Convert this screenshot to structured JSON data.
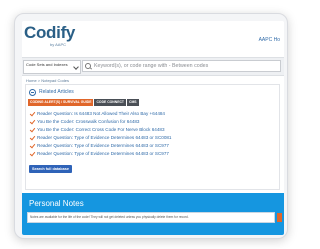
{
  "header": {
    "logo_text": "Codify",
    "logo_byline": "by AAPC",
    "right_link": "AAPC Ho"
  },
  "search": {
    "code_select_label": "Code Sets and Indexes",
    "placeholder": "Keyword(s), or code range with - Between codes"
  },
  "breadcrumb": "Home > Notepad Codes",
  "articles": {
    "title": "Related Articles",
    "tabs": [
      {
        "label": "CODING ALERT(S) / SURVIVAL GUIDE"
      },
      {
        "label": "CODE CONNECT"
      },
      {
        "label": "CMS"
      }
    ],
    "items": [
      "Reader Question: Is 64483 Not Allowed Their Also Bay +64484",
      "You Be the Coder: Crosswalk Confusion for 64483",
      "You Be the Coder: Correct Cross Code For Nerve Block 64483",
      "Reader Question: Type of Evidence Determines 64483 or SC0081",
      "Reader Question: Type of Evidence Determines 64483 or SC977",
      "Reader Question: Type of Evidence Determines 64483 or SC977"
    ],
    "full_db_button": "Search full database"
  },
  "notes": {
    "title": "Personal Notes",
    "text": "Notes are available for the life of the code! They will not get deleted unless you physically delete them for record."
  },
  "colors": {
    "brand": "#2a5f86",
    "link": "#2f6aa8",
    "accent": "#e0662a",
    "notes_bar": "#1596e0"
  }
}
